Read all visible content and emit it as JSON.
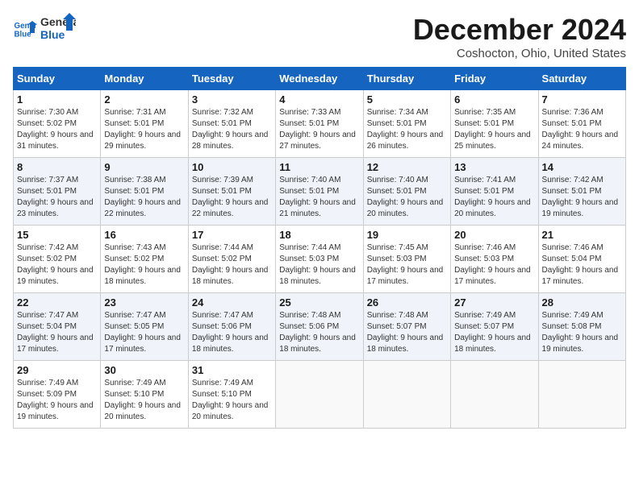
{
  "header": {
    "logo_line1": "General",
    "logo_line2": "Blue",
    "month_title": "December 2024",
    "location": "Coshocton, Ohio, United States"
  },
  "calendar": {
    "days_of_week": [
      "Sunday",
      "Monday",
      "Tuesday",
      "Wednesday",
      "Thursday",
      "Friday",
      "Saturday"
    ],
    "weeks": [
      [
        {
          "day": "1",
          "sunrise": "7:30 AM",
          "sunset": "5:02 PM",
          "daylight": "9 hours and 31 minutes."
        },
        {
          "day": "2",
          "sunrise": "7:31 AM",
          "sunset": "5:01 PM",
          "daylight": "9 hours and 29 minutes."
        },
        {
          "day": "3",
          "sunrise": "7:32 AM",
          "sunset": "5:01 PM",
          "daylight": "9 hours and 28 minutes."
        },
        {
          "day": "4",
          "sunrise": "7:33 AM",
          "sunset": "5:01 PM",
          "daylight": "9 hours and 27 minutes."
        },
        {
          "day": "5",
          "sunrise": "7:34 AM",
          "sunset": "5:01 PM",
          "daylight": "9 hours and 26 minutes."
        },
        {
          "day": "6",
          "sunrise": "7:35 AM",
          "sunset": "5:01 PM",
          "daylight": "9 hours and 25 minutes."
        },
        {
          "day": "7",
          "sunrise": "7:36 AM",
          "sunset": "5:01 PM",
          "daylight": "9 hours and 24 minutes."
        }
      ],
      [
        {
          "day": "8",
          "sunrise": "7:37 AM",
          "sunset": "5:01 PM",
          "daylight": "9 hours and 23 minutes."
        },
        {
          "day": "9",
          "sunrise": "7:38 AM",
          "sunset": "5:01 PM",
          "daylight": "9 hours and 22 minutes."
        },
        {
          "day": "10",
          "sunrise": "7:39 AM",
          "sunset": "5:01 PM",
          "daylight": "9 hours and 22 minutes."
        },
        {
          "day": "11",
          "sunrise": "7:40 AM",
          "sunset": "5:01 PM",
          "daylight": "9 hours and 21 minutes."
        },
        {
          "day": "12",
          "sunrise": "7:40 AM",
          "sunset": "5:01 PM",
          "daylight": "9 hours and 20 minutes."
        },
        {
          "day": "13",
          "sunrise": "7:41 AM",
          "sunset": "5:01 PM",
          "daylight": "9 hours and 20 minutes."
        },
        {
          "day": "14",
          "sunrise": "7:42 AM",
          "sunset": "5:01 PM",
          "daylight": "9 hours and 19 minutes."
        }
      ],
      [
        {
          "day": "15",
          "sunrise": "7:42 AM",
          "sunset": "5:02 PM",
          "daylight": "9 hours and 19 minutes."
        },
        {
          "day": "16",
          "sunrise": "7:43 AM",
          "sunset": "5:02 PM",
          "daylight": "9 hours and 18 minutes."
        },
        {
          "day": "17",
          "sunrise": "7:44 AM",
          "sunset": "5:02 PM",
          "daylight": "9 hours and 18 minutes."
        },
        {
          "day": "18",
          "sunrise": "7:44 AM",
          "sunset": "5:03 PM",
          "daylight": "9 hours and 18 minutes."
        },
        {
          "day": "19",
          "sunrise": "7:45 AM",
          "sunset": "5:03 PM",
          "daylight": "9 hours and 17 minutes."
        },
        {
          "day": "20",
          "sunrise": "7:46 AM",
          "sunset": "5:03 PM",
          "daylight": "9 hours and 17 minutes."
        },
        {
          "day": "21",
          "sunrise": "7:46 AM",
          "sunset": "5:04 PM",
          "daylight": "9 hours and 17 minutes."
        }
      ],
      [
        {
          "day": "22",
          "sunrise": "7:47 AM",
          "sunset": "5:04 PM",
          "daylight": "9 hours and 17 minutes."
        },
        {
          "day": "23",
          "sunrise": "7:47 AM",
          "sunset": "5:05 PM",
          "daylight": "9 hours and 17 minutes."
        },
        {
          "day": "24",
          "sunrise": "7:47 AM",
          "sunset": "5:06 PM",
          "daylight": "9 hours and 18 minutes."
        },
        {
          "day": "25",
          "sunrise": "7:48 AM",
          "sunset": "5:06 PM",
          "daylight": "9 hours and 18 minutes."
        },
        {
          "day": "26",
          "sunrise": "7:48 AM",
          "sunset": "5:07 PM",
          "daylight": "9 hours and 18 minutes."
        },
        {
          "day": "27",
          "sunrise": "7:49 AM",
          "sunset": "5:07 PM",
          "daylight": "9 hours and 18 minutes."
        },
        {
          "day": "28",
          "sunrise": "7:49 AM",
          "sunset": "5:08 PM",
          "daylight": "9 hours and 19 minutes."
        }
      ],
      [
        {
          "day": "29",
          "sunrise": "7:49 AM",
          "sunset": "5:09 PM",
          "daylight": "9 hours and 19 minutes."
        },
        {
          "day": "30",
          "sunrise": "7:49 AM",
          "sunset": "5:10 PM",
          "daylight": "9 hours and 20 minutes."
        },
        {
          "day": "31",
          "sunrise": "7:49 AM",
          "sunset": "5:10 PM",
          "daylight": "9 hours and 20 minutes."
        },
        null,
        null,
        null,
        null
      ]
    ]
  }
}
